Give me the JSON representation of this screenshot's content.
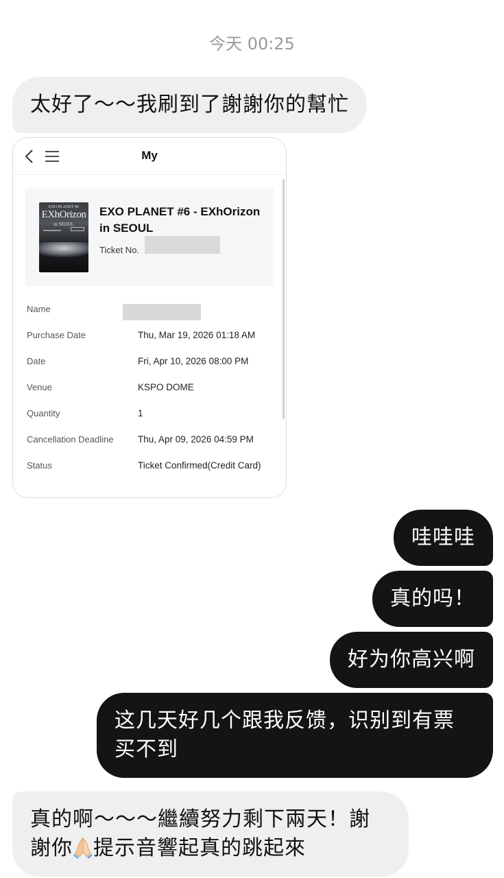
{
  "timestamp": "今天 00:25",
  "messages": {
    "in_1": "太好了～～我刷到了謝謝你的幫忙",
    "out_1": "哇哇哇",
    "out_2": "真的吗！",
    "out_3": "好为你高兴啊",
    "out_4": "这几天好几个跟我反馈，识别到有票买不到",
    "in_2_before_emoji": "真的啊～～～繼續努力剩下兩天！謝謝你",
    "in_2_after_emoji": "提示音響起真的跳起來"
  },
  "ticket_screenshot": {
    "header_title": "My",
    "poster": {
      "top_text": "EXO PLANET #6",
      "logo_text": "EXhOrizon",
      "sub_text": "in SEOUL"
    },
    "event_title": "EXO PLANET #6 - EXhOrizon in SEOUL",
    "ticket_no_label": "Ticket No.",
    "details": [
      {
        "label": "Name",
        "value": ""
      },
      {
        "label": "Purchase Date",
        "value": "Thu, Mar 19, 2026 01:18 AM"
      },
      {
        "label": "Date",
        "value": "Fri, Apr 10, 2026 08:00 PM"
      },
      {
        "label": "Venue",
        "value": "KSPO DOME"
      },
      {
        "label": "Quantity",
        "value": "1"
      },
      {
        "label": "Cancellation Deadline",
        "value": "Thu, Apr 09, 2026 04:59 PM"
      },
      {
        "label": "Status",
        "value": "Ticket Confirmed(Credit Card)"
      }
    ]
  },
  "icons": {
    "back": "chevron-left-icon",
    "menu": "hamburger-menu-icon",
    "emoji": "folded-hands-emoji"
  },
  "colors": {
    "incoming_bubble": "#efefef",
    "outgoing_bubble": "#141414",
    "timestamp": "#9a9a9a"
  }
}
